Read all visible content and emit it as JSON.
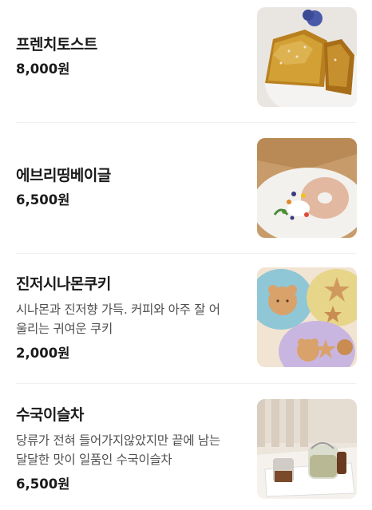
{
  "menu": {
    "items": [
      {
        "name": "프렌치토스트",
        "description": "",
        "price": "8,000원",
        "image_icon": "french-toast-photo"
      },
      {
        "name": "에브리띵베이글",
        "description": "",
        "price": "6,500원",
        "image_icon": "everything-bagel-photo"
      },
      {
        "name": "진저시나몬쿠키",
        "description_line1": "시나몬과 진저향 가득. 커피와 아주 잘 어",
        "description_line2": "울리는 귀여운 쿠키",
        "price": "2,000원",
        "image_icon": "ginger-cookie-photo"
      },
      {
        "name": "수국이슬차",
        "description_line1": "당류가 전혀 들어가지않았지만 끝에 남는",
        "description_line2": "달달한 맛이 일품인 수국이슬차",
        "price": "6,500원",
        "image_icon": "hydrangea-tea-photo"
      }
    ]
  }
}
